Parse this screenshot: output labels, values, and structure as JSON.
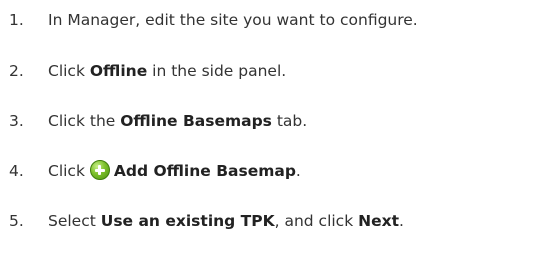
{
  "steps": [
    {
      "number": "1.",
      "text": "In Manager, edit the site you want to configure."
    },
    {
      "number": "2.",
      "before": "Click ",
      "bold": "Offline",
      "after": " in the side panel."
    },
    {
      "number": "3.",
      "before": "Click the ",
      "bold": "Offline Basemaps",
      "after": " tab."
    },
    {
      "number": "4.",
      "before": "Click ",
      "icon": "add-circle-icon",
      "bold": "Add Offline Basemap",
      "after": "."
    },
    {
      "number": "5.",
      "before": "Select ",
      "bold": "Use an existing TPK",
      "middle": ", and click ",
      "bold2": "Next",
      "after": "."
    }
  ]
}
